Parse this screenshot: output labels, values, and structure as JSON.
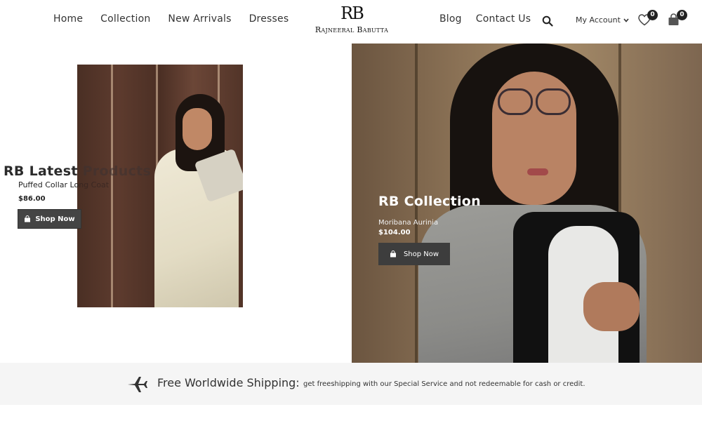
{
  "nav": {
    "left": [
      "Home",
      "Collection",
      "New Arrivals",
      "Dresses"
    ],
    "right": [
      "Blog",
      "Contact Us"
    ]
  },
  "logo": {
    "mark": "RB",
    "name": "Rajneeral Babutta"
  },
  "account": {
    "label": "My Account"
  },
  "wishlist": {
    "count": "0"
  },
  "cart": {
    "count": "0"
  },
  "latest": {
    "heading_strong": "RB Latest ",
    "heading_faded": "Products",
    "product_strong": "Puffed Collar Lo",
    "product_faded": "ng Coat",
    "price": "$86.00",
    "button": "Shop Now"
  },
  "hero": {
    "title": "RB Collection",
    "product": "Moribana Aurinia",
    "price": "$104.00",
    "button": "Shop Now"
  },
  "shipping": {
    "title": "Free Worldwide Shipping:",
    "text": "get freeshipping with our Special Service and not redeemable for cash or credit."
  },
  "icons": [
    "search-icon",
    "chevron-down-icon",
    "heart-icon",
    "shopping-bag-icon",
    "airplane-icon"
  ],
  "colors": {
    "button_bg": "#444444",
    "banner_bg": "#f5f5f5",
    "badge_bg": "#222222"
  }
}
